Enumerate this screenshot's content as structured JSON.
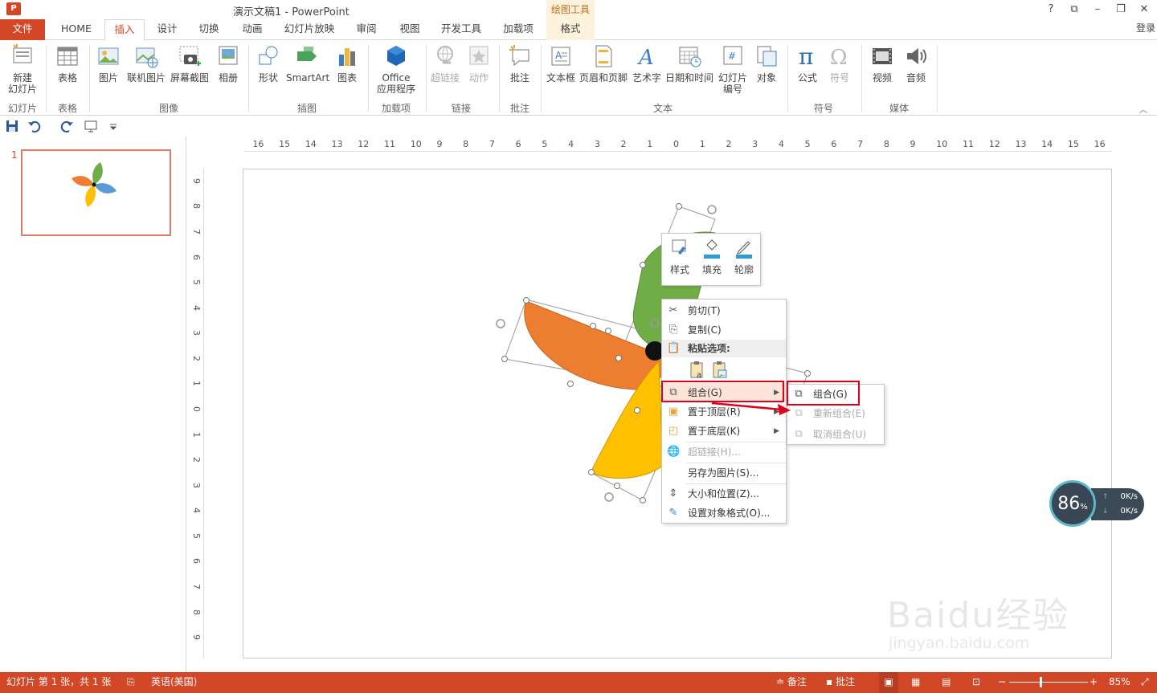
{
  "window": {
    "app_icon_text": "P",
    "title": "演示文稿1 - PowerPoint",
    "contextual_tab_group": "绘图工具",
    "help": "?",
    "restore_ribbon": "⧉",
    "minimize": "–",
    "maximize": "❐",
    "close": "✕",
    "login": "登录"
  },
  "tabs": [
    "文件",
    "HOME",
    "插入",
    "设计",
    "切换",
    "动画",
    "幻灯片放映",
    "审阅",
    "视图",
    "开发工具",
    "加载项",
    "格式"
  ],
  "ribbon": {
    "new_slide": "新建\n幻灯片",
    "table": "表格",
    "picture": "图片",
    "online_picture": "联机图片",
    "screenshot": "屏幕截图",
    "album": "相册",
    "shapes": "形状",
    "smartart": "SmartArt",
    "chart": "图表",
    "office_apps_line1": "Office",
    "office_apps_line2": "应用程序",
    "hyperlink": "超链接",
    "action": "动作",
    "comment": "批注",
    "textbox": "文本框",
    "header_footer": "页眉和页脚",
    "wordart": "艺术字",
    "datetime": "日期和时间",
    "slide_number_line1": "幻灯片",
    "slide_number_line2": "编号",
    "object": "对象",
    "equation": "公式",
    "symbol": "符号",
    "video": "视频",
    "audio": "音频",
    "groups": {
      "slides": "幻灯片",
      "tables": "表格",
      "images": "图像",
      "illustrations": "插图",
      "addins": "加载项",
      "links": "链接",
      "comments": "批注",
      "text": "文本",
      "symbols": "符号",
      "media": "媒体"
    }
  },
  "thumbnail": {
    "slide_number": "1"
  },
  "ruler": {
    "h_ticks": [
      "16",
      "15",
      "14",
      "13",
      "12",
      "11",
      "10",
      "9",
      "8",
      "7",
      "6",
      "5",
      "4",
      "3",
      "2",
      "1",
      "0",
      "1",
      "2",
      "3",
      "4",
      "5",
      "6",
      "7",
      "8",
      "9",
      "10",
      "11",
      "12",
      "13",
      "14",
      "15",
      "16"
    ],
    "v_ticks": [
      "9",
      "8",
      "7",
      "6",
      "5",
      "4",
      "3",
      "2",
      "1",
      "0",
      "1",
      "2",
      "3",
      "4",
      "5",
      "6",
      "7",
      "8",
      "9"
    ]
  },
  "mini_toolbar": {
    "style": "样式",
    "fill": "填充",
    "outline": "轮廓"
  },
  "context_menu": {
    "cut": "剪切(T)",
    "copy": "复制(C)",
    "paste_options": "粘贴选项:",
    "group": "组合(G)",
    "bring_front": "置于顶层(R)",
    "send_back": "置于底层(K)",
    "hyperlink": "超链接(H)...",
    "save_as_picture": "另存为图片(S)...",
    "size_position": "大小和位置(Z)...",
    "format_object": "设置对象格式(O)..."
  },
  "submenu": {
    "group": "组合(G)",
    "regroup": "重新组合(E)",
    "ungroup": "取消组合(U)"
  },
  "speed_widget": {
    "percent": "86",
    "percent_unit": "%",
    "upload": "0K/s",
    "download": "0K/s"
  },
  "watermark": {
    "brand": "Baidu经验",
    "url": "jingyan.baidu.com"
  },
  "status": {
    "slide_info": "幻灯片 第 1 张，共 1 张",
    "language": "英语(美国)",
    "notes": "备注",
    "comments": "批注",
    "zoom": "85%"
  },
  "colors": {
    "accent": "#d24726",
    "green_blade": "#70ad47",
    "orange_blade": "#ed7d31",
    "yellow_blade": "#ffc000",
    "blue_blade": "#5b9bd5"
  }
}
